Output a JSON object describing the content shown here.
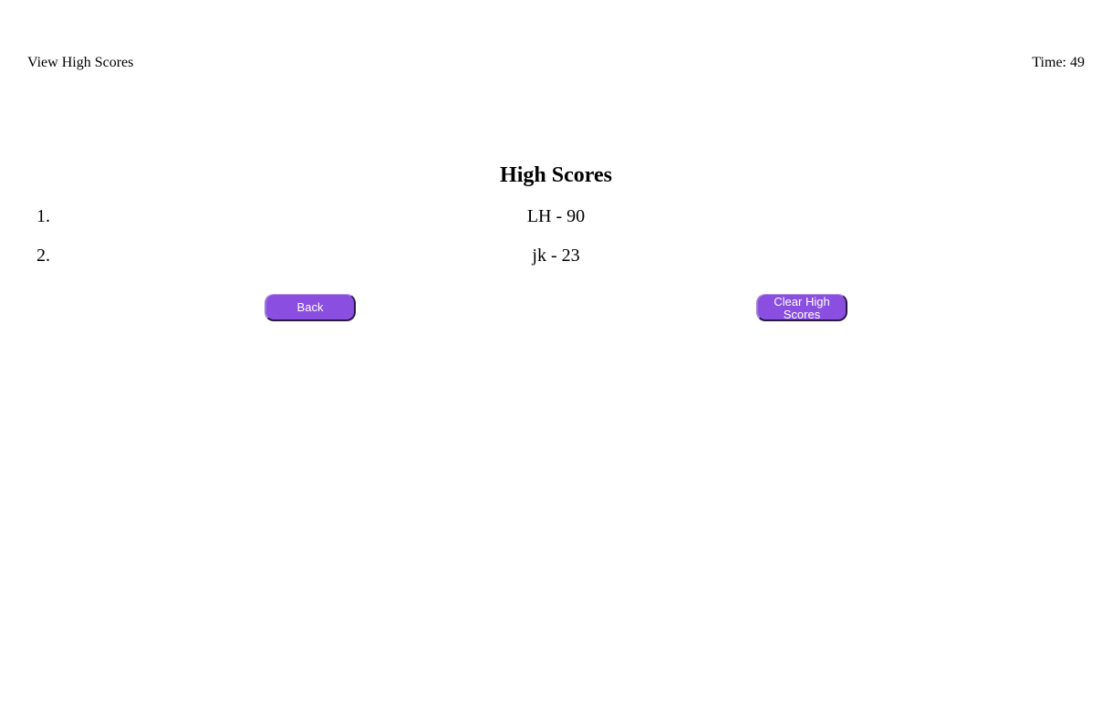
{
  "header": {
    "view_high_scores": "View High Scores",
    "timer": "Time: 49"
  },
  "main": {
    "title": "High Scores",
    "scores": [
      {
        "rank": "1.",
        "entry": "LH - 90"
      },
      {
        "rank": "2.",
        "entry": "jk - 23"
      }
    ],
    "back_label": "Back",
    "clear_label": "Clear High Scores"
  },
  "colors": {
    "button_background": "#8a4fe0",
    "button_text": "#ffffff",
    "page_background": "#ffffff"
  }
}
